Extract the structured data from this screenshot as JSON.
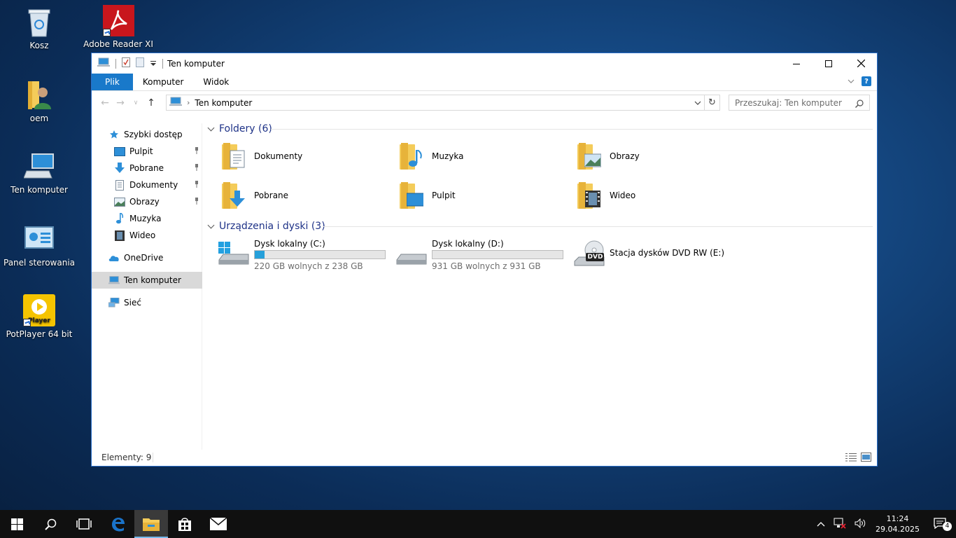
{
  "desktop": {
    "icons": [
      {
        "label": "Kosz",
        "icon": "recycle-bin-icon"
      },
      {
        "label": "Adobe Reader XI",
        "icon": "adobe-reader-icon"
      },
      {
        "label": "oem",
        "icon": "user-folder-icon"
      },
      {
        "label": "Ten komputer",
        "icon": "computer-icon"
      },
      {
        "label": "Panel sterowania",
        "icon": "control-panel-icon"
      },
      {
        "label": "PotPlayer 64 bit",
        "icon": "potplayer-icon"
      }
    ]
  },
  "window": {
    "title": "Ten komputer",
    "tabs": [
      {
        "label": "Plik"
      },
      {
        "label": "Komputer"
      },
      {
        "label": "Widok"
      }
    ],
    "address": {
      "location": "Ten komputer"
    },
    "search": {
      "placeholder": "Przeszukaj: Ten komputer"
    },
    "sidebar": {
      "quick_access": "Szybki dostęp",
      "items": [
        {
          "label": "Pulpit",
          "pinned": true
        },
        {
          "label": "Pobrane",
          "pinned": true
        },
        {
          "label": "Dokumenty",
          "pinned": true
        },
        {
          "label": "Obrazy",
          "pinned": true
        },
        {
          "label": "Muzyka",
          "pinned": false
        },
        {
          "label": "Wideo",
          "pinned": false
        }
      ],
      "onedrive": "OneDrive",
      "this_pc": "Ten komputer",
      "network": "Sieć"
    },
    "folders": {
      "header": "Foldery (6)",
      "items": [
        {
          "label": "Dokumenty",
          "icon": "documents-folder-icon"
        },
        {
          "label": "Muzyka",
          "icon": "music-folder-icon"
        },
        {
          "label": "Obrazy",
          "icon": "pictures-folder-icon"
        },
        {
          "label": "Pobrane",
          "icon": "downloads-folder-icon"
        },
        {
          "label": "Pulpit",
          "icon": "desktop-folder-icon"
        },
        {
          "label": "Wideo",
          "icon": "videos-folder-icon"
        }
      ]
    },
    "devices": {
      "header": "Urządzenia i dyski (3)",
      "items": [
        {
          "label": "Dysk lokalny (C:)",
          "free": "220 GB wolnych z 238 GB",
          "used_fraction": 0.076
        },
        {
          "label": "Dysk lokalny (D:)",
          "free": "931 GB wolnych z 931 GB",
          "used_fraction": 0.0
        },
        {
          "label": "Stacja dysków DVD RW (E:)",
          "badge": "DVD"
        }
      ]
    },
    "status": {
      "count": "Elementy: 9"
    }
  },
  "taskbar": {
    "time": "11:24",
    "date": "29.04.2025",
    "notification_count": "4"
  },
  "colors": {
    "accent": "#1979ca",
    "group_header": "#1e3287",
    "drive_bar": "#26a0da",
    "folder": "#f4cc5a"
  }
}
